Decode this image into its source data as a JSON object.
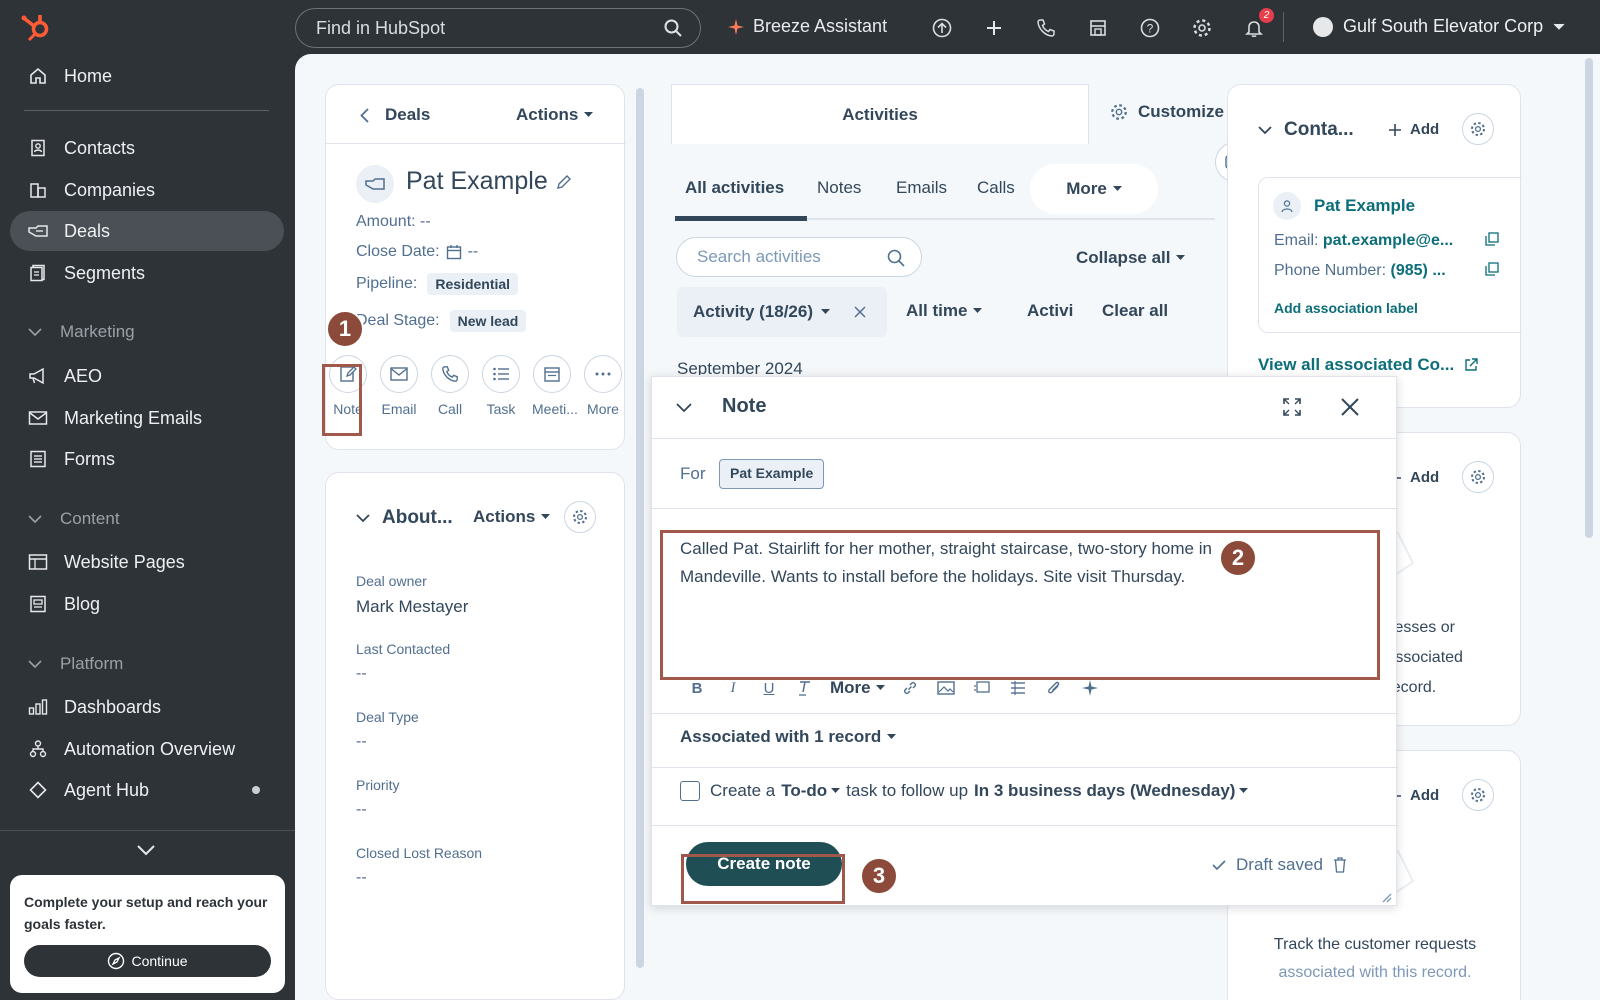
{
  "topbar": {
    "search_placeholder": "Find in HubSpot",
    "breeze_label": "Breeze Assistant",
    "notification_count": "2",
    "account_name": "Gulf South Elevator Corp"
  },
  "sidebar": {
    "home": "Home",
    "contacts": "Contacts",
    "companies": "Companies",
    "deals": "Deals",
    "segments": "Segments",
    "marketing_section": "Marketing",
    "aeo": "AEO",
    "marketing_emails": "Marketing Emails",
    "forms": "Forms",
    "content_section": "Content",
    "website_pages": "Website Pages",
    "blog": "Blog",
    "platform_section": "Platform",
    "dashboards": "Dashboards",
    "automation_overview": "Automation Overview",
    "agent_hub": "Agent Hub",
    "setup_text": "Complete your setup and reach your goals faster.",
    "continue_label": "Continue"
  },
  "left_panel": {
    "back_label": "Deals",
    "actions_label": "Actions",
    "record_name": "Pat Example",
    "amount_label": "Amount:",
    "amount_value": "--",
    "close_date_label": "Close Date:",
    "close_date_value": "--",
    "pipeline_label": "Pipeline:",
    "pipeline_value": "Residential",
    "deal_stage_label": "Deal Stage:",
    "deal_stage_value": "New lead",
    "action_buttons": [
      "Note",
      "Email",
      "Call",
      "Task",
      "Meeti...",
      "More"
    ],
    "about_title": "About...",
    "about_actions": "Actions",
    "deal_owner_label": "Deal owner",
    "deal_owner_value": "Mark Mestayer",
    "last_contacted_label": "Last Contacted",
    "last_contacted_value": "--",
    "deal_type_label": "Deal Type",
    "deal_type_value": "--",
    "priority_label": "Priority",
    "priority_value": "--",
    "closed_lost_label": "Closed Lost Reason",
    "closed_lost_value": "--"
  },
  "center": {
    "activities_tab": "Activities",
    "customize_label": "Customize",
    "tabs": [
      "All activities",
      "Notes",
      "Emails",
      "Calls",
      "More"
    ],
    "search_placeholder": "Search activities",
    "collapse_all": "Collapse all",
    "activity_filter": "Activity (18/26)",
    "time_filter": "All time",
    "activity_short": "Activi",
    "clear_all": "Clear all",
    "month_heading": "September 2024"
  },
  "note_modal": {
    "title": "Note",
    "for_label": "For",
    "for_value": "Pat Example",
    "body_line1": "Called Pat. Stairlift for her mother, straight staircase, two-story ",
    "body_hidden": "home",
    "body_line1_end": " in",
    "body_line2": "Mandeville. Wants to install before the holidays. Site visit Thursday.",
    "toolbar_more": "More",
    "associated": "Associated with 1 record",
    "todo_prefix": "Create a",
    "todo_type": "To-do",
    "todo_middle": "task to follow up",
    "todo_when": "In 3 business days (Wednesday)",
    "create_button": "Create note",
    "draft_saved": "Draft saved"
  },
  "right_panel": {
    "contacts_title": "Conta...",
    "add_label": "Add",
    "contact_name": "Pat Example",
    "email_label": "Email:",
    "email_value": "pat.example@e...",
    "phone_label": "Phone Number:",
    "phone_value": "(985) ...",
    "add_association_label": "Add association label",
    "view_all": "View all associated Co...",
    "companies_add": "Add",
    "companies_empty_1": "sinesses or",
    "companies_empty_2": "s associated",
    "companies_empty_3": "s record.",
    "tickets_add": "Add",
    "tickets_empty_1": "Track the customer requests",
    "tickets_empty_2": "associated with this record."
  },
  "callouts": [
    "1",
    "2",
    "3"
  ],
  "colors": {
    "dark_bg": "#2e3338",
    "primary_button": "#1f4f55",
    "link": "#0b6e79",
    "callout": "#8b4a3a"
  }
}
